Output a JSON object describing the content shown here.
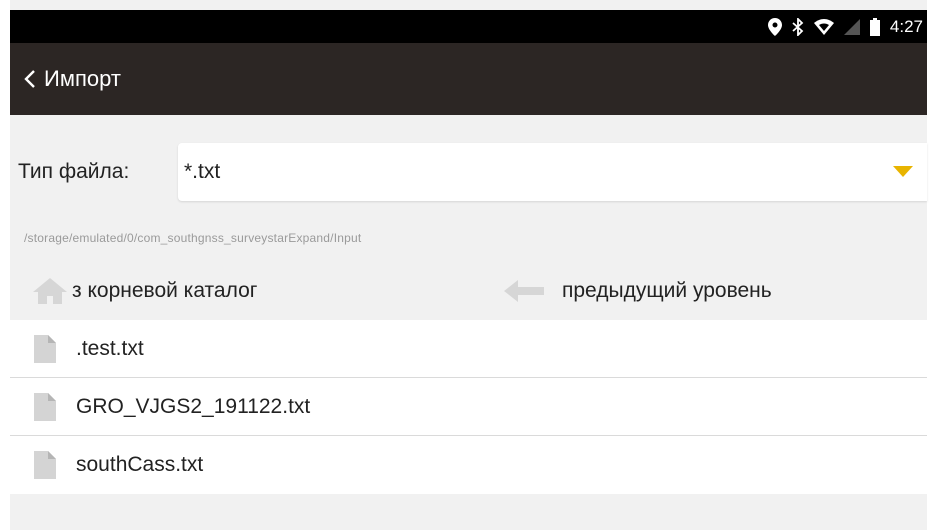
{
  "status_bar": {
    "time": "4:27",
    "icons": [
      "location-icon",
      "bluetooth-icon",
      "wifi-icon",
      "no-sim-icon",
      "battery-icon"
    ]
  },
  "header": {
    "back_icon": "chevron-left-icon",
    "title": "Импорт"
  },
  "filter": {
    "label": "Тип файла:",
    "value": "*.txt",
    "arrow_color": "#e8b400"
  },
  "path": "/storage/emulated/0/com_southgnss_surveystarExpand/Input",
  "nav": {
    "root_label": "з корневой каталог",
    "root_icon": "home-icon",
    "up_label": "предыдущий уровень",
    "up_icon": "back-arrow-icon"
  },
  "files": [
    {
      "name": ".test.txt",
      "icon": "file-icon"
    },
    {
      "name": "GRO_VJGS2_191122.txt",
      "icon": "file-icon"
    },
    {
      "name": "southCass.txt",
      "icon": "file-icon"
    }
  ],
  "colors": {
    "status_bar_bg": "#000000",
    "app_bar_bg": "#2c2624",
    "content_bg": "#f1f1f1",
    "accent": "#e8b400"
  }
}
